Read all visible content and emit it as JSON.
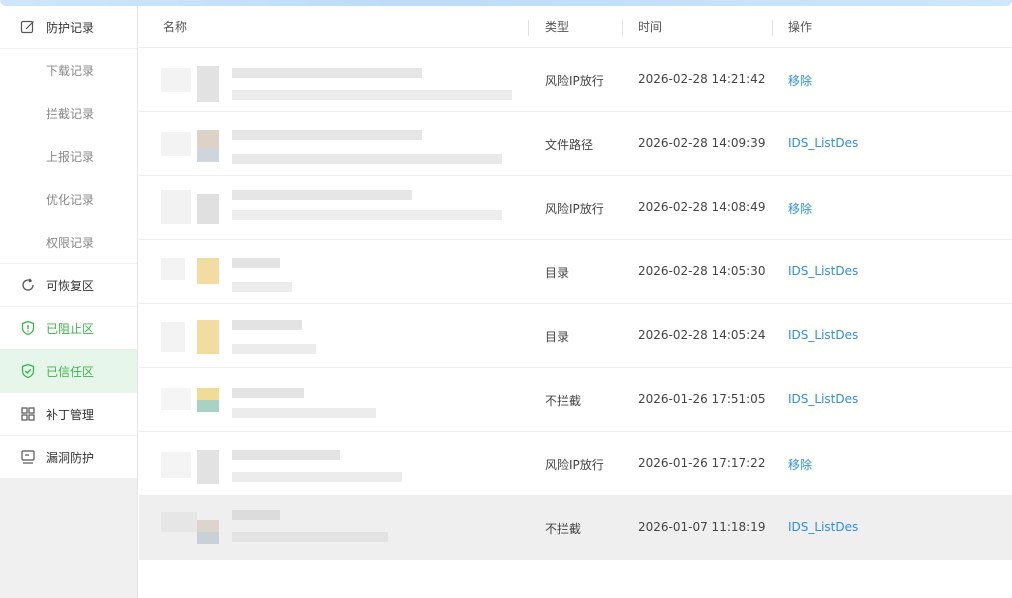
{
  "sidebar": {
    "items": [
      {
        "label": "防护记录",
        "icon": "edit-icon"
      },
      {
        "label": "下载记录"
      },
      {
        "label": "拦截记录"
      },
      {
        "label": "上报记录"
      },
      {
        "label": "优化记录"
      },
      {
        "label": "权限记录"
      },
      {
        "label": "可恢复区",
        "icon": "refresh-icon"
      },
      {
        "label": "已阻止区",
        "icon": "shield-alert-icon"
      },
      {
        "label": "已信任区",
        "icon": "shield-check-icon"
      },
      {
        "label": "补丁管理",
        "icon": "grid-icon"
      },
      {
        "label": "漏洞防护",
        "icon": "monitor-icon"
      }
    ]
  },
  "table": {
    "columns": {
      "name": "名称",
      "type": "类型",
      "time": "时间",
      "action": "操作"
    },
    "rows": [
      {
        "type": "风险IP放行",
        "time": "2026-02-28 14:21:42",
        "action": "移除"
      },
      {
        "type": "文件路径",
        "time": "2026-02-28 14:09:39",
        "action": "IDS_ListDes"
      },
      {
        "type": "风险IP放行",
        "time": "2026-02-28 14:08:49",
        "action": "移除"
      },
      {
        "type": "目录",
        "time": "2026-02-28 14:05:30",
        "action": "IDS_ListDes"
      },
      {
        "type": "目录",
        "time": "2026-02-28 14:05:24",
        "action": "IDS_ListDes"
      },
      {
        "type": "不拦截",
        "time": "2026-01-26 17:51:05",
        "action": "IDS_ListDes"
      },
      {
        "type": "风险IP放行",
        "time": "2026-01-26 17:17:22",
        "action": "移除"
      },
      {
        "type": "不拦截",
        "time": "2026-01-07 11:18:19",
        "action": "IDS_ListDes"
      }
    ]
  },
  "colors": {
    "accent_green": "#3bb54a",
    "link_blue": "#2f8fe0",
    "active_bg": "#e7f6ea"
  }
}
